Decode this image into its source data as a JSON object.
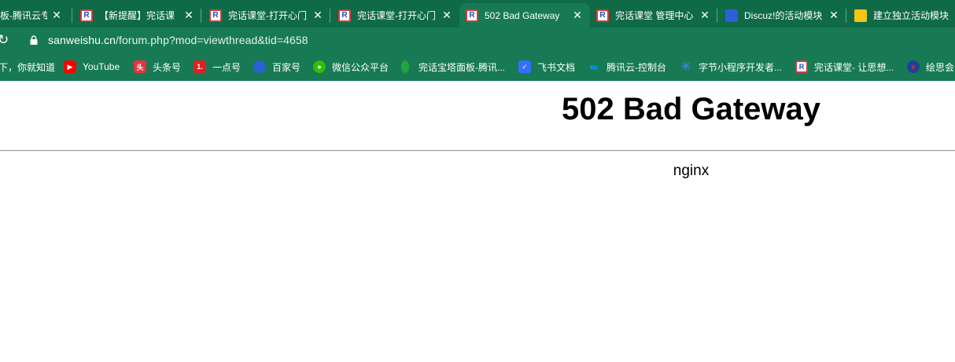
{
  "tabs": [
    {
      "title": "板-腾讯云专",
      "icon": "none-icon"
    },
    {
      "title": "【新提醒】完话课",
      "icon": "site-logo-icon"
    },
    {
      "title": "完话课堂-打开心门",
      "icon": "site-logo-icon"
    },
    {
      "title": "完话课堂-打开心门",
      "icon": "site-logo-icon"
    },
    {
      "title": "502 Bad Gateway",
      "icon": "site-logo-icon",
      "active": true
    },
    {
      "title": "完话课堂 管理中心",
      "icon": "site-logo-icon"
    },
    {
      "title": "Discuz!的活动模块",
      "icon": "baidu-icon"
    },
    {
      "title": "建立独立活动模块",
      "icon": "folder-icon"
    }
  ],
  "address": {
    "host": "sanweishu.cn",
    "path": "/forum.php?mod=viewthread&tid=4658"
  },
  "bookmarks": [
    {
      "label": "下，你就知道",
      "icon": "none-icon"
    },
    {
      "label": "YouTube",
      "icon": "youtube-icon"
    },
    {
      "label": "头条号",
      "icon": "toutiao-icon"
    },
    {
      "label": "一点号",
      "icon": "yidian-icon"
    },
    {
      "label": "百家号",
      "icon": "baidu-icon"
    },
    {
      "label": "微信公众平台",
      "icon": "wechat-icon"
    },
    {
      "label": "完话宝塔面板-腾讯...",
      "icon": "baota-icon"
    },
    {
      "label": "飞书文档",
      "icon": "feishu-icon"
    },
    {
      "label": "腾讯云-控制台",
      "icon": "tencent-cloud-icon"
    },
    {
      "label": "字节小程序开发者...",
      "icon": "bytedance-icon"
    },
    {
      "label": "完话课堂- 让思想...",
      "icon": "site-logo-icon"
    },
    {
      "label": "绘思会",
      "icon": "huisi-icon"
    }
  ],
  "page": {
    "heading": "502 Bad Gateway",
    "server": "nginx"
  },
  "colors": {
    "tabstrip": "#0f6a47",
    "toolbar": "#177a55",
    "page_bg": "#ffffff"
  }
}
